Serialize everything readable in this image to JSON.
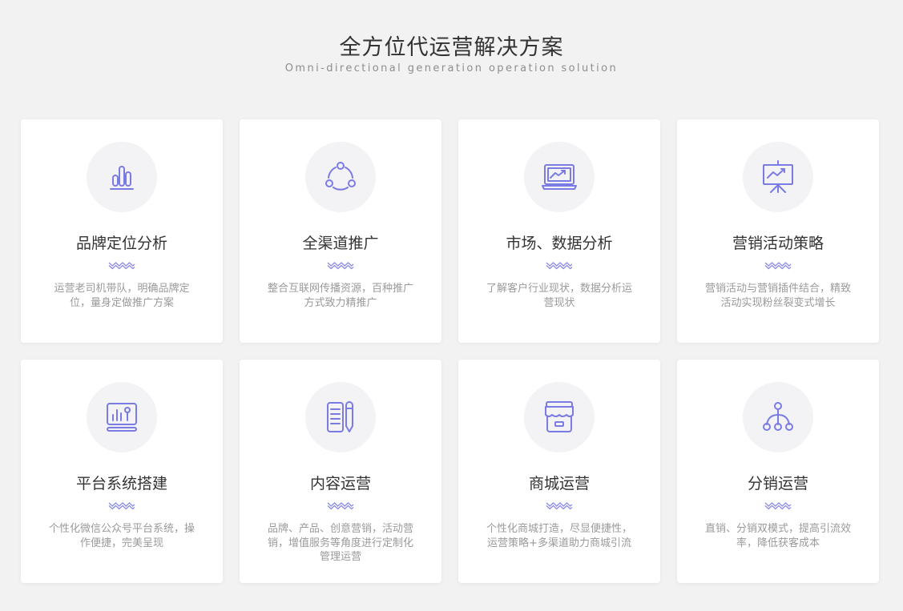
{
  "header": {
    "title": "全方位代运营解决方案",
    "subtitle": "Omni-directional generation operation solution"
  },
  "colors": {
    "accent": "#7b7be4",
    "background": "#f2f2f2",
    "card": "#ffffff",
    "icon_circle": "#f3f3f6"
  },
  "cards": [
    {
      "icon": "bar-chart-icon",
      "title": "品牌定位分析",
      "desc": "运营老司机带队，明确品牌定位，量身定做推广方案"
    },
    {
      "icon": "share-cycle-icon",
      "title": "全渠道推广",
      "desc": "整合互联网传播资源，百种推广方式致力精推广"
    },
    {
      "icon": "monitor-trend-icon",
      "title": "市场、数据分析",
      "desc": "了解客户行业现状，数据分析运营现状"
    },
    {
      "icon": "presentation-board-icon",
      "title": "营销活动策略",
      "desc": "营销活动与营销插件结合，精致活动实现粉丝裂变式增长"
    },
    {
      "icon": "platform-tools-icon",
      "title": "平台系统搭建",
      "desc": "个性化微信公众号平台系统，操作便捷，完美呈现"
    },
    {
      "icon": "document-pencil-icon",
      "title": "内容运营",
      "desc": "品牌、产品、创意营销，活动营销，增值服务等角度进行定制化管理运营"
    },
    {
      "icon": "storefront-icon",
      "title": "商城运营",
      "desc": "个性化商城打造，尽显便捷性，运营策略+多渠道助力商城引流"
    },
    {
      "icon": "distribution-network-icon",
      "title": "分销运营",
      "desc": "直销、分销双模式，提高引流效率，降低获客成本"
    }
  ]
}
